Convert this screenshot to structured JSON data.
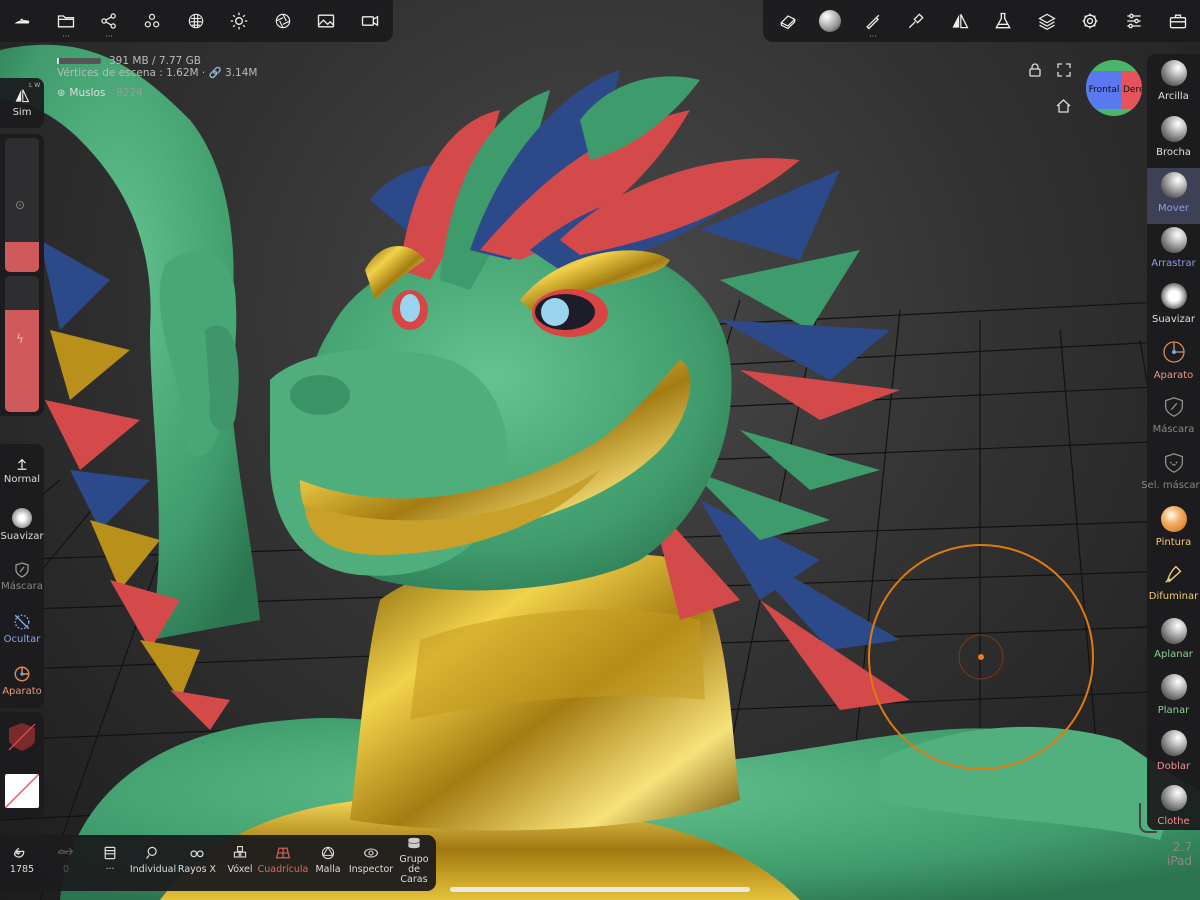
{
  "top_left_toolbar": {
    "items": [
      {
        "name": "menu-logo-icon",
        "dots": ""
      },
      {
        "name": "folder-icon",
        "dots": "···"
      },
      {
        "name": "scene-graph-icon",
        "dots": "···"
      },
      {
        "name": "multiresolution-icon",
        "dots": ""
      },
      {
        "name": "material-sphere-icon",
        "dots": ""
      },
      {
        "name": "light-icon",
        "dots": ""
      },
      {
        "name": "aperture-icon",
        "dots": ""
      },
      {
        "name": "image-icon",
        "dots": ""
      },
      {
        "name": "camera-icon",
        "dots": ""
      }
    ]
  },
  "top_right_toolbar": {
    "items": [
      {
        "name": "eraser-tool-icon",
        "dots": ""
      },
      {
        "name": "matcap-sphere-icon",
        "dots": ""
      },
      {
        "name": "stroke-brush-icon",
        "dots": "···"
      },
      {
        "name": "paint-brush-icon",
        "dots": ""
      },
      {
        "name": "symmetry-icon",
        "dots": ""
      },
      {
        "name": "flask-icon",
        "dots": ""
      },
      {
        "name": "layers-icon",
        "dots": ""
      },
      {
        "name": "settings-gear-icon",
        "dots": ""
      },
      {
        "name": "sliders-icon",
        "dots": ""
      },
      {
        "name": "briefcase-icon",
        "dots": ""
      }
    ]
  },
  "stats": {
    "memory": "391 MB / 7.77 GB",
    "vertices": "Vértices de escena : 1.62M · 🔗 3.14M",
    "object_name": "Muslos",
    "object_count": "· 8224"
  },
  "left_panel": {
    "sym": "Sim",
    "sym_badge": "L W",
    "normal": "Normal",
    "suavizar": "Suavizar",
    "mascara": "Máscara",
    "ocultar": "Ocultar",
    "aparato": "Aparato"
  },
  "right_tools": [
    {
      "label": "Arcilla",
      "color": "#e0e0e0",
      "active": false,
      "style": "sphere"
    },
    {
      "label": "Brocha",
      "color": "#e0e0e0",
      "active": false,
      "style": "sphere"
    },
    {
      "label": "Mover",
      "color": "#8f9cf0",
      "active": true,
      "style": "sphere"
    },
    {
      "label": "Arrastrar",
      "color": "#8f9cf0",
      "active": false,
      "style": "sphere"
    },
    {
      "label": "Suavizar",
      "color": "#e0e0e0",
      "active": false,
      "style": "sphere-noisy"
    },
    {
      "label": "Aparato",
      "color": "#e79a7a",
      "active": false,
      "style": "gizmo"
    },
    {
      "label": "Máscara",
      "color": "#888888",
      "active": false,
      "style": "shield"
    },
    {
      "label": "Sel. máscara",
      "color": "#888888",
      "active": false,
      "style": "shield-lasso"
    },
    {
      "label": "Pintura",
      "color": "#f0cc70",
      "active": false,
      "style": "orange"
    },
    {
      "label": "Difuminar",
      "color": "#f0cc70",
      "active": false,
      "style": "smudge"
    },
    {
      "label": "Aplanar",
      "color": "#8fd08f",
      "active": false,
      "style": "sphere"
    },
    {
      "label": "Planar",
      "color": "#8fd08f",
      "active": false,
      "style": "sphere"
    },
    {
      "label": "Doblar",
      "color": "#f29090",
      "active": false,
      "style": "sphere"
    },
    {
      "label": "Clothe",
      "color": "#f29090",
      "active": false,
      "style": "sphere"
    }
  ],
  "bottom_bar": {
    "undo_count": "1785",
    "redo_count": "0",
    "dots": "···",
    "buttons": [
      {
        "name": "individual-button",
        "label": "Individual",
        "color": "#dddddd"
      },
      {
        "name": "rayos-x-button",
        "label": "Rayos X",
        "color": "#dddddd"
      },
      {
        "name": "voxel-button",
        "label": "Vóxel",
        "color": "#dddddd"
      },
      {
        "name": "cuadricula-button",
        "label": "Cuadrícula",
        "color": "#e0675f"
      },
      {
        "name": "malla-button",
        "label": "Malla",
        "color": "#dddddd"
      },
      {
        "name": "inspector-button",
        "label": "Inspector",
        "color": "#dddddd"
      },
      {
        "name": "grupo-caras-button",
        "label": "Grupo de Caras",
        "color": "#dddddd"
      }
    ]
  },
  "view_cube": {
    "front": "Frontal",
    "right": "Dere"
  },
  "version": {
    "number": "2.7",
    "device": "iPad"
  },
  "colors": {
    "accent": "#e0675f",
    "panel": "#1c1c1e",
    "active_tool_bg": "#3e4055",
    "brush_ring": "#e07a10"
  }
}
